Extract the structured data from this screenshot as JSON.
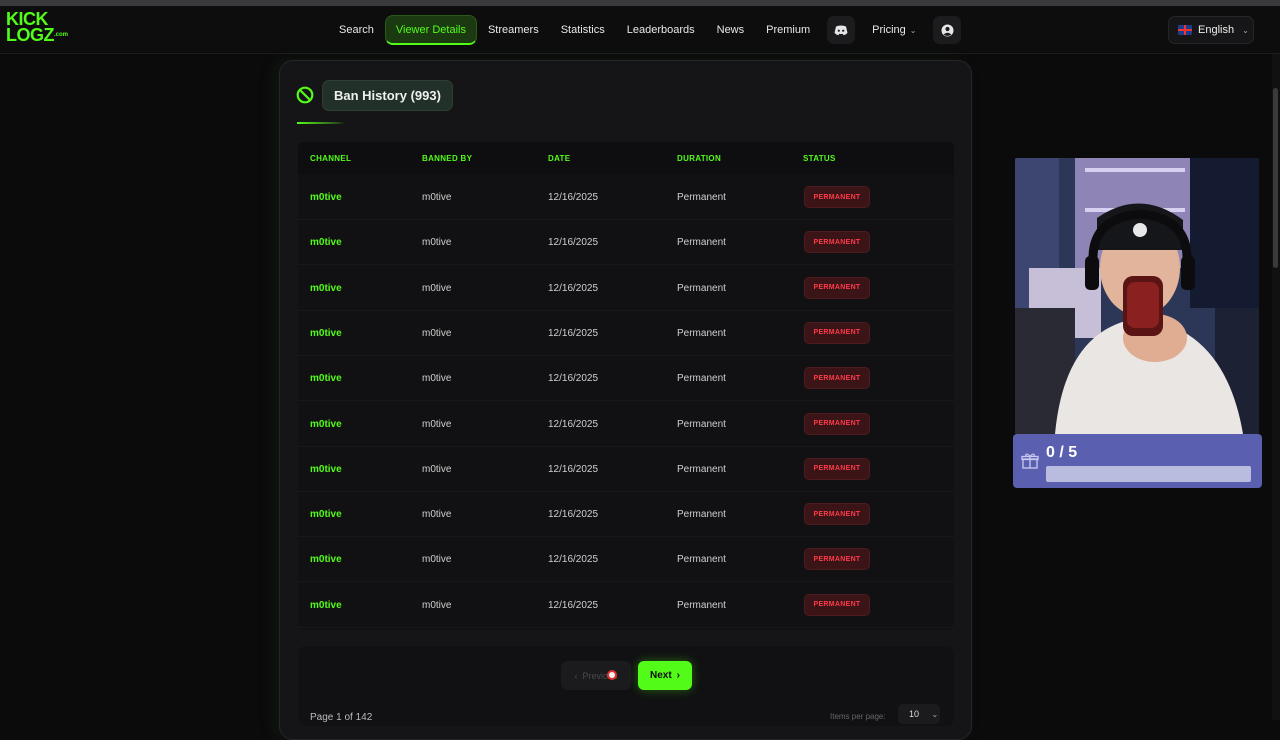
{
  "header": {
    "logo_line1": "KICK",
    "logo_line2": "LOGZ",
    "logo_suffix": ".com",
    "nav": [
      {
        "label": "Search",
        "active": false
      },
      {
        "label": "Viewer Details",
        "active": true
      },
      {
        "label": "Streamers",
        "active": false
      },
      {
        "label": "Statistics",
        "active": false
      },
      {
        "label": "Leaderboards",
        "active": false
      },
      {
        "label": "News",
        "active": false
      },
      {
        "label": "Premium",
        "active": false
      }
    ],
    "pricing_label": "Pricing",
    "language_label": "English"
  },
  "ban_history": {
    "title": "Ban History (993)",
    "columns": [
      "CHANNEL",
      "BANNED BY",
      "DATE",
      "DURATION",
      "STATUS"
    ],
    "rows": [
      {
        "channel": "m0tive",
        "banned_by": "m0tive",
        "date": "12/16/2025",
        "duration": "Permanent",
        "status": "PERMANENT"
      },
      {
        "channel": "m0tive",
        "banned_by": "m0tive",
        "date": "12/16/2025",
        "duration": "Permanent",
        "status": "PERMANENT"
      },
      {
        "channel": "m0tive",
        "banned_by": "m0tive",
        "date": "12/16/2025",
        "duration": "Permanent",
        "status": "PERMANENT"
      },
      {
        "channel": "m0tive",
        "banned_by": "m0tive",
        "date": "12/16/2025",
        "duration": "Permanent",
        "status": "PERMANENT"
      },
      {
        "channel": "m0tive",
        "banned_by": "m0tive",
        "date": "12/16/2025",
        "duration": "Permanent",
        "status": "PERMANENT"
      },
      {
        "channel": "m0tive",
        "banned_by": "m0tive",
        "date": "12/16/2025",
        "duration": "Permanent",
        "status": "PERMANENT"
      },
      {
        "channel": "m0tive",
        "banned_by": "m0tive",
        "date": "12/16/2025",
        "duration": "Permanent",
        "status": "PERMANENT"
      },
      {
        "channel": "m0tive",
        "banned_by": "m0tive",
        "date": "12/16/2025",
        "duration": "Permanent",
        "status": "PERMANENT"
      },
      {
        "channel": "m0tive",
        "banned_by": "m0tive",
        "date": "12/16/2025",
        "duration": "Permanent",
        "status": "PERMANENT"
      },
      {
        "channel": "m0tive",
        "banned_by": "m0tive",
        "date": "12/16/2025",
        "duration": "Permanent",
        "status": "PERMANENT"
      }
    ]
  },
  "pagination": {
    "previous_label": "Previous",
    "next_label": "Next",
    "page_info": "Page 1 of 142",
    "items_per_page_label": "Items per page:",
    "items_per_page_value": "10"
  },
  "overlay": {
    "goal_text": "0 / 5",
    "goal_progress": 0
  },
  "colors": {
    "accent": "#53fc18",
    "danger": "#ff3b4a",
    "background": "#0b0b0c",
    "goal_panel": "#5b5fb0"
  }
}
